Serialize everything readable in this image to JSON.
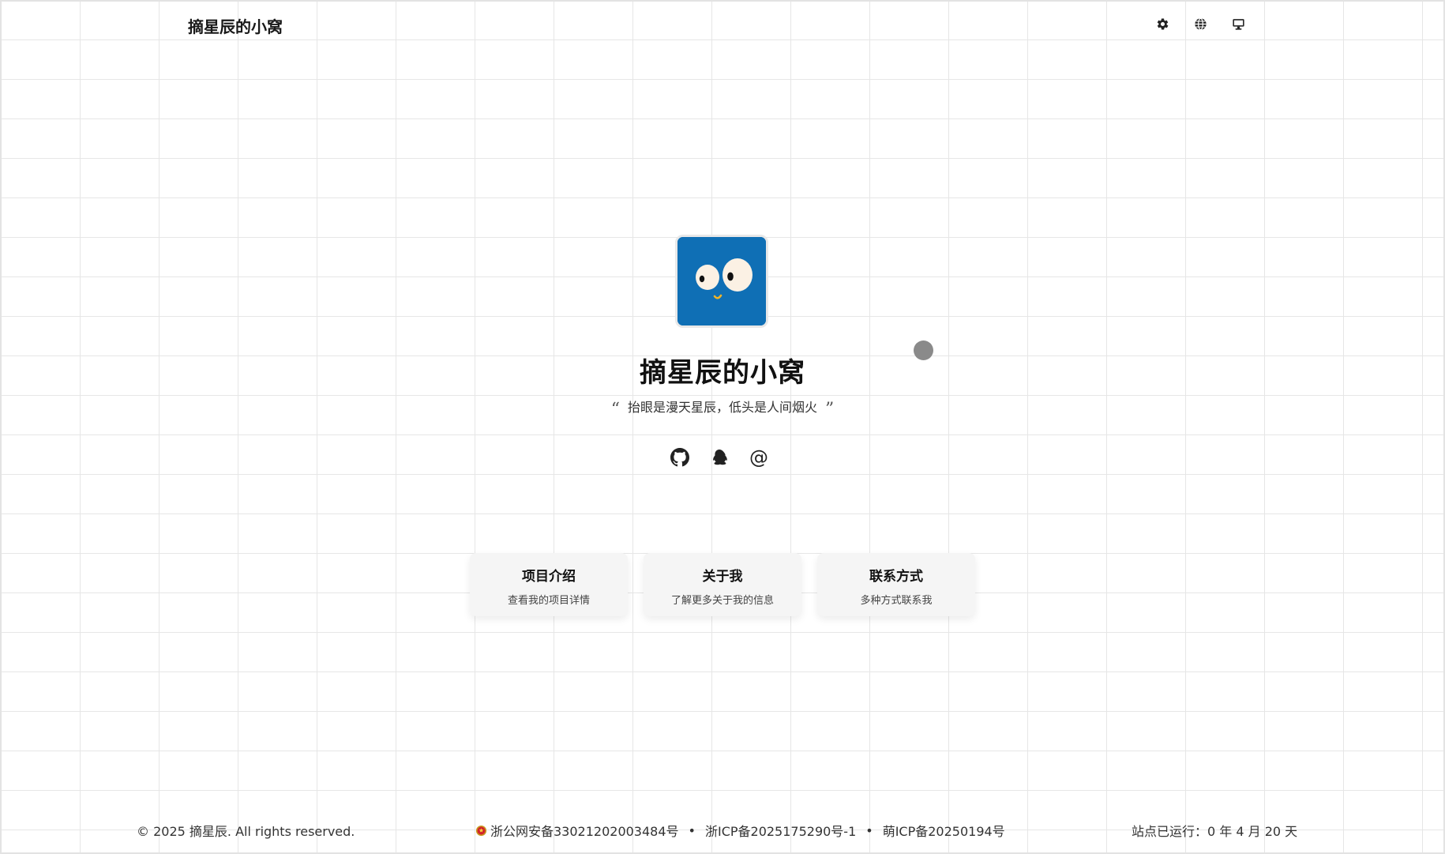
{
  "header": {
    "site_title": "摘星辰的小窝",
    "actions": [
      {
        "icon": "gear-icon",
        "name": "settings"
      },
      {
        "icon": "globe-icon",
        "name": "language"
      },
      {
        "icon": "monitor-icon",
        "name": "theme"
      }
    ]
  },
  "hero": {
    "title": "摘星辰的小窝",
    "motto_open": "“",
    "motto": "抬眼是漫天星辰，低头是人间烟火",
    "motto_close": "”",
    "avatar_bg": "#0f6fb5",
    "social": [
      {
        "icon": "github-icon",
        "label": ""
      },
      {
        "icon": "qq-icon",
        "label": ""
      },
      {
        "icon": "at-icon",
        "label": "@"
      }
    ]
  },
  "cards": [
    {
      "title": "项目介绍",
      "desc": "查看我的项目详情"
    },
    {
      "title": "关于我",
      "desc": "了解更多关于我的信息"
    },
    {
      "title": "联系方式",
      "desc": "多种方式联系我"
    }
  ],
  "footer": {
    "copyright": "© 2025 摘星辰. All rights reserved.",
    "police_record": "浙公网安备33021202003484号",
    "separator": "•",
    "icp_record": "浙ICP备2025175290号-1",
    "moe_icp_record": "萌ICP备20250194号",
    "runtime": "站点已运行：0 年 4 月 20 天"
  },
  "colors": {
    "grid_line": "#e6e6e6",
    "card_bg": "#f5f5f5",
    "text": "#1a1a1a"
  }
}
